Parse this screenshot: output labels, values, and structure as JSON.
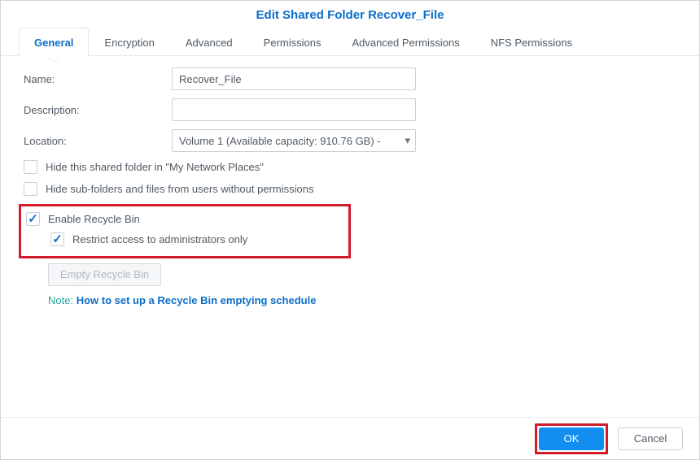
{
  "header": {
    "title": "Edit Shared Folder Recover_File"
  },
  "tabs": [
    {
      "label": "General"
    },
    {
      "label": "Encryption"
    },
    {
      "label": "Advanced"
    },
    {
      "label": "Permissions"
    },
    {
      "label": "Advanced Permissions"
    },
    {
      "label": "NFS Permissions"
    }
  ],
  "form": {
    "name_label": "Name:",
    "name_value": "Recover_File",
    "description_label": "Description:",
    "description_value": "",
    "location_label": "Location:",
    "location_value": "Volume 1 (Available capacity: 910.76 GB) -"
  },
  "checkboxes": {
    "hide_network": "Hide this shared folder in \"My Network Places\"",
    "hide_subfolders": "Hide sub-folders and files from users without permissions",
    "enable_recycle": "Enable Recycle Bin",
    "restrict_admins": "Restrict access to administrators only"
  },
  "buttons": {
    "empty_recycle": "Empty Recycle Bin",
    "ok": "OK",
    "cancel": "Cancel"
  },
  "note": {
    "prefix": "Note: ",
    "link": "How to set up a Recycle Bin emptying schedule"
  }
}
